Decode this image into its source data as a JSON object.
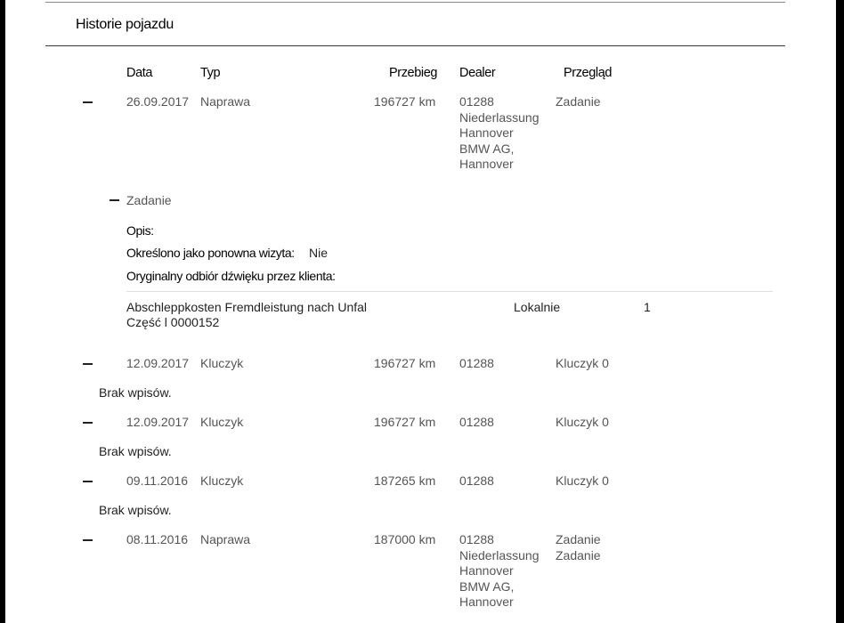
{
  "title": "Historie pojazdu",
  "columns": {
    "date": "Data",
    "type": "Typ",
    "mileage": "Przebieg",
    "dealer": "Dealer",
    "review": "Przegląd"
  },
  "entry1": {
    "date": "26.09.2017",
    "type": "Naprawa",
    "mileage": "196727 km",
    "dealer_lines": [
      "01288",
      "Niederlassung",
      "Hannover",
      "BMW AG,",
      "Hannover"
    ],
    "review": "Zadanie",
    "detail": {
      "section_label": "Zadanie",
      "description_label": "Opis:",
      "revisit_label": "Określono jako ponowna wizyta:",
      "revisit_value": "Nie",
      "reception_label": "Oryginalny odbiór dźwięku przez klienta:",
      "part_name": "Abschleppkosten Fremdleistung nach Unfal",
      "part_number": "Część l 0000152",
      "location": "Lokalnie",
      "quantity": "1"
    }
  },
  "entry2": {
    "date": "12.09.2017",
    "type": "Kluczyk",
    "mileage": "196727 km",
    "dealer": "01288",
    "review": "Kluczyk 0",
    "note": "Brak wpisów."
  },
  "entry3": {
    "date": "12.09.2017",
    "type": "Kluczyk",
    "mileage": "196727 km",
    "dealer": "01288",
    "review": "Kluczyk 0",
    "note": "Brak wpisów."
  },
  "entry4": {
    "date": "09.11.2016",
    "type": "Kluczyk",
    "mileage": "187265 km",
    "dealer": "01288",
    "review": "Kluczyk 0",
    "note": "Brak wpisów."
  },
  "entry5": {
    "date": "08.11.2016",
    "type": "Naprawa",
    "mileage": "187000 km",
    "dealer_lines": [
      "01288",
      "Niederlassung",
      "Hannover",
      "BMW AG,",
      "Hannover"
    ],
    "review_lines": [
      "Zadanie",
      "Zadanie"
    ]
  }
}
